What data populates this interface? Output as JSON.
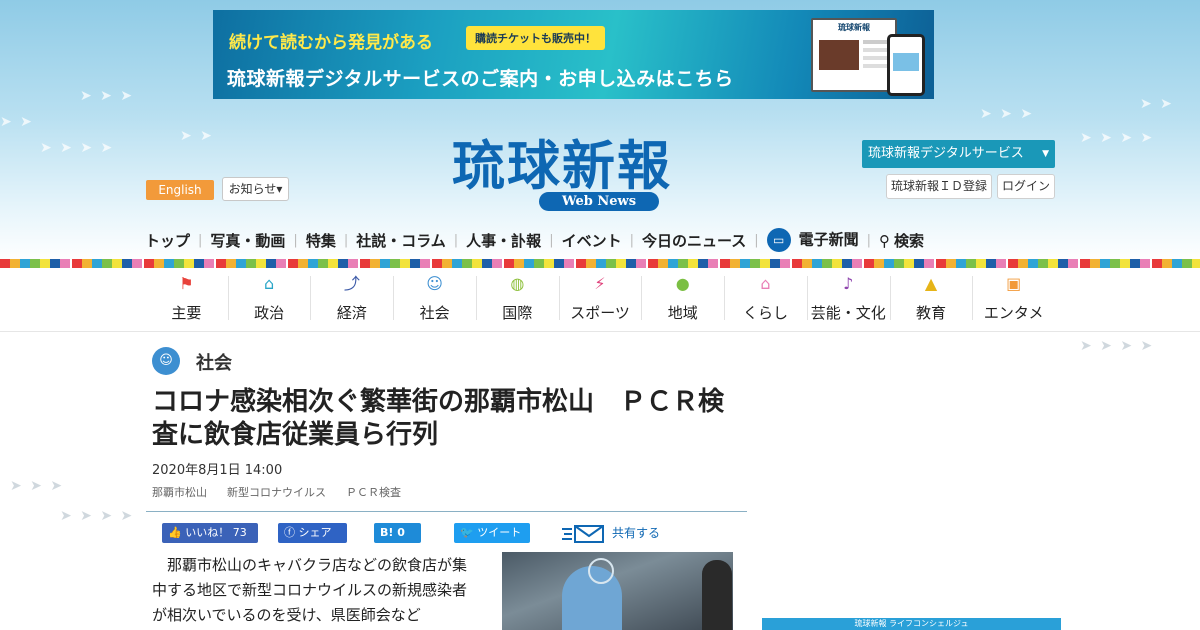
{
  "banner": {
    "headline": "続けて読むから発見がある",
    "ticket": "購読チケットも販売中！",
    "main": "琉球新報デジタルサービスのご案内・お申し込みはこちら",
    "device_logo": "琉球新報"
  },
  "header": {
    "logo": "琉球新報",
    "logo_sub": "Web News",
    "english": "English",
    "notice": "お知らせ▾",
    "digital_service": "琉球新報デジタルサービス",
    "id_register": "琉球新報ＩＤ登録",
    "login": "ログイン"
  },
  "topnav": {
    "items": [
      "トップ",
      "写真・動画",
      "特集",
      "社説・コラム",
      "人事・訃報",
      "イベント",
      "今日のニュース",
      "電子新聞",
      "検索"
    ]
  },
  "categories": [
    {
      "label": "主要",
      "icon": "flag-icon",
      "color": "#e8413a"
    },
    {
      "label": "政治",
      "icon": "building-icon",
      "color": "#2aa6c8"
    },
    {
      "label": "経済",
      "icon": "chart-icon",
      "color": "#3c5aa8"
    },
    {
      "label": "社会",
      "icon": "people-icon",
      "color": "#3d8fd1"
    },
    {
      "label": "国際",
      "icon": "globe-icon",
      "color": "#8dbf3a"
    },
    {
      "label": "スポーツ",
      "icon": "runner-icon",
      "color": "#e0457d"
    },
    {
      "label": "地域",
      "icon": "pin-icon",
      "color": "#7bbf43"
    },
    {
      "label": "くらし",
      "icon": "house-icon",
      "color": "#e97fb6"
    },
    {
      "label": "芸能・文化",
      "icon": "mic-icon",
      "color": "#8e44ad"
    },
    {
      "label": "教育",
      "icon": "cap-icon",
      "color": "#e6b418"
    },
    {
      "label": "エンタメ",
      "icon": "tv-icon",
      "color": "#f29a3a"
    }
  ],
  "article": {
    "section": "社会",
    "title": "コロナ感染相次ぐ繁華街の那覇市松山　ＰＣＲ検査に飲食店従業員ら行列",
    "date": "2020年8月1日 14:00",
    "tags": [
      "那覇市松山",
      "新型コロナウイルス",
      "ＰＣＲ検査"
    ],
    "body": "　那覇市松山のキャバクラ店などの飲食店が集中する地区で新型コロナウイルスの新規感染者が相次いでいるのを受け、県医師会など"
  },
  "share": {
    "like": "いいね！ 73",
    "facebook": "シェア",
    "hatena": "B! 0",
    "twitter": "ツイート",
    "share_more": "共有する"
  },
  "sidebar": {
    "banner": "琉球新報 ライフコンシェルジュ"
  },
  "colors": {
    "brand": "#0e67b3",
    "accent_orange": "#f29a3a",
    "digital_button": "#1a98b8"
  }
}
